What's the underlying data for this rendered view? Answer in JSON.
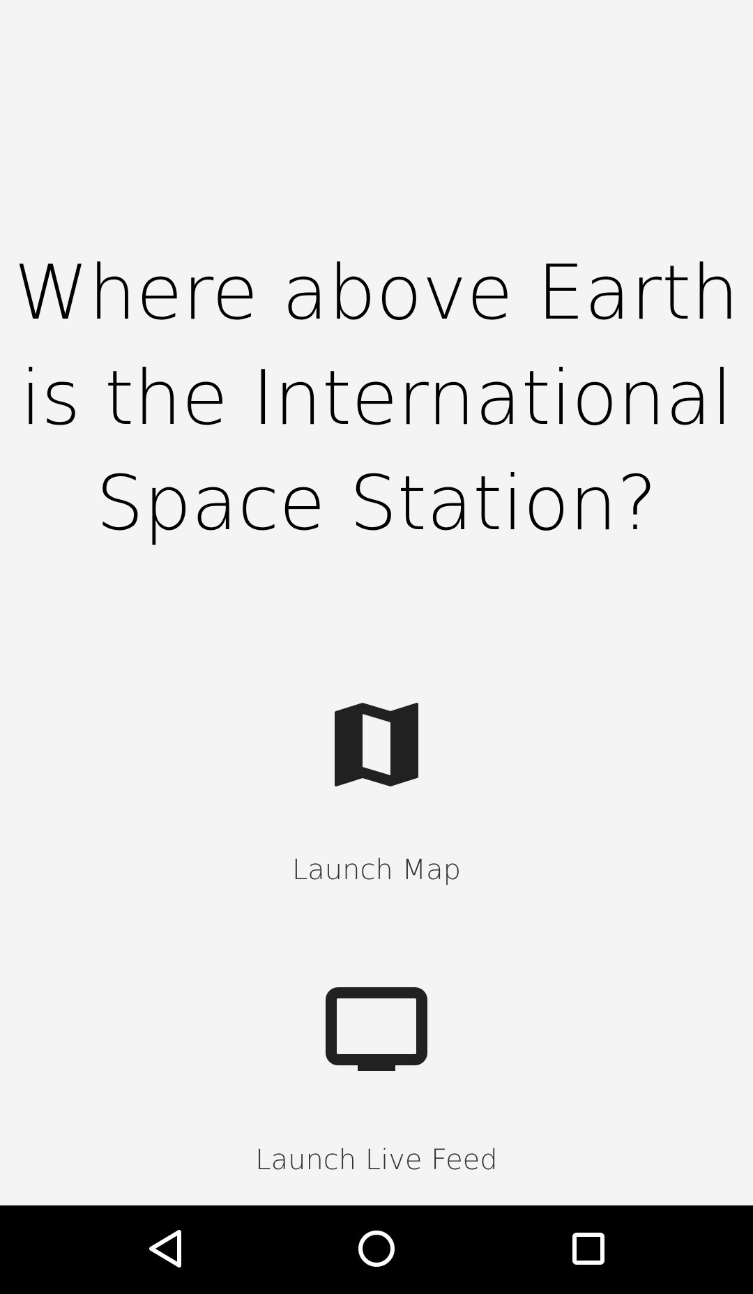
{
  "main": {
    "headline": "Where above Earth is the International Space Station?",
    "actions": [
      {
        "label": "Launch Map",
        "icon": "map-icon"
      },
      {
        "label": "Launch Live Feed",
        "icon": "tv-icon"
      }
    ]
  },
  "navigation_bar": {
    "buttons": [
      {
        "name": "back",
        "icon": "back-triangle-icon"
      },
      {
        "name": "home",
        "icon": "home-circle-icon"
      },
      {
        "name": "recents",
        "icon": "recents-square-icon"
      }
    ]
  },
  "colors": {
    "background": "#f4f4f4",
    "headline": "#000000",
    "icon": "#212121",
    "label": "#333333",
    "nav_bar": "#000000",
    "nav_icon": "#ffffff"
  }
}
